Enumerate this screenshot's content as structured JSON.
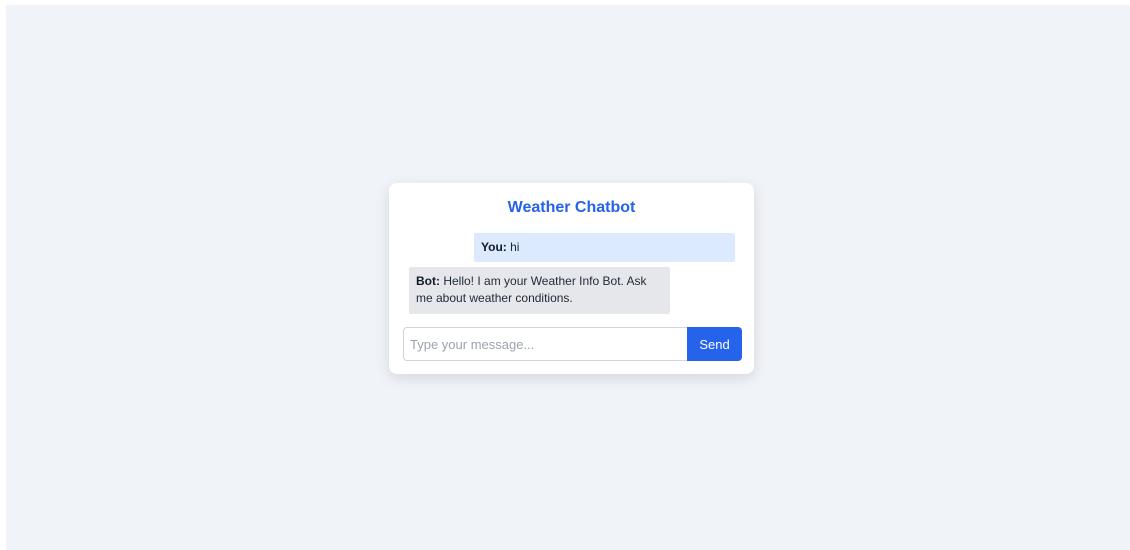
{
  "app": {
    "title": "Weather Chatbot"
  },
  "messages": [
    {
      "role": "user",
      "speaker": "You:",
      "text": " hi"
    },
    {
      "role": "bot",
      "speaker": "Bot:",
      "text": " Hello! I am your Weather Info Bot. Ask me about weather conditions."
    }
  ],
  "composer": {
    "placeholder": "Type your message...",
    "value": "",
    "send_label": "Send"
  },
  "colors": {
    "accent": "#2563eb",
    "user_bubble": "#dbeafe",
    "bot_bubble": "#e5e7eb",
    "page_background": "#f0f3f7"
  }
}
